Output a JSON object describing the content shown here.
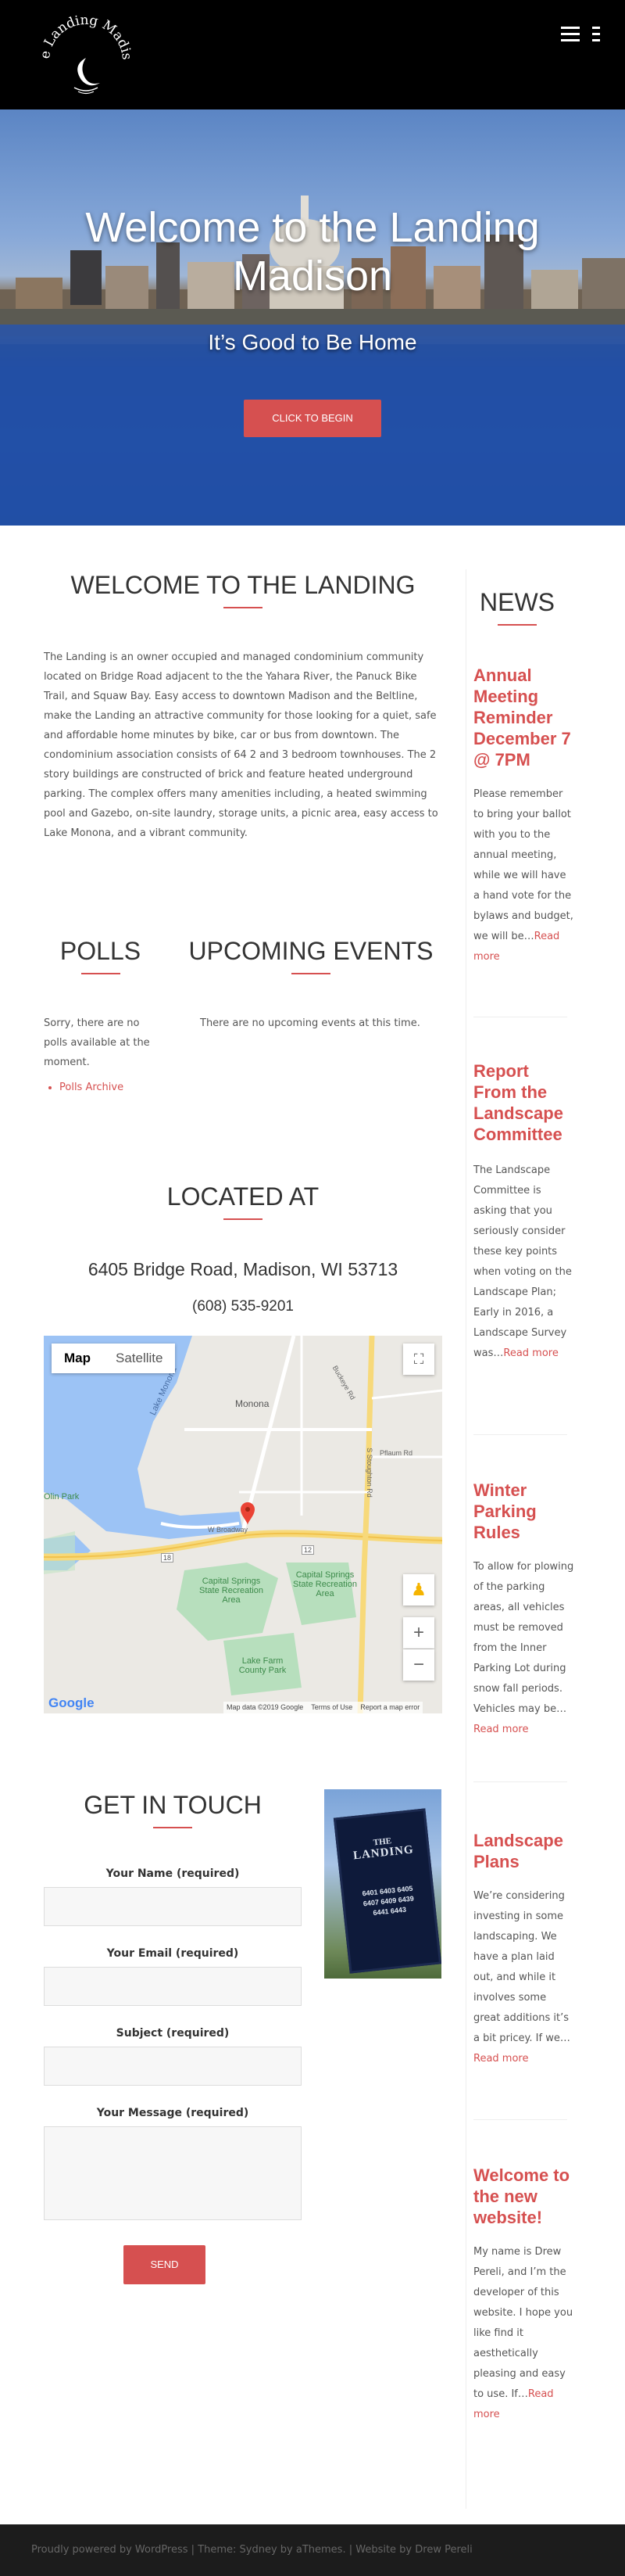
{
  "site": {
    "logo_text": "The Landing Madison",
    "menu_icon": "hamburger-icon"
  },
  "hero": {
    "title": "Welcome to the Landing Madison",
    "subtitle": "It’s Good to Be Home",
    "button": "CLICK TO BEGIN"
  },
  "welcome": {
    "heading": "WELCOME TO THE LANDING",
    "text": "The Landing is an owner occupied and managed condominium community located on Bridge Road adjacent to the the Yahara River, the Panuck Bike Trail, and Squaw Bay. Easy access to downtown Madison and the Beltline, make the Landing an attractive community for those looking for a quiet, safe and affordable home minutes by bike, car or bus from downtown. The condominium association consists of 64 2 and 3 bedroom townhouses. The 2 story buildings are constructed of brick and feature heated underground parking. The complex offers many amenities including, a heated swimming pool and Gazebo, on-site laundry, storage units, a picnic area, easy access to Lake Monona, and a vibrant community."
  },
  "polls": {
    "heading": "POLLS",
    "text": "Sorry, there are no polls available at the moment.",
    "archive_link": "Polls Archive"
  },
  "events": {
    "heading": "UPCOMING EVENTS",
    "text": "There are no upcoming events at this time."
  },
  "location": {
    "heading": "LOCATED AT",
    "address": "6405 Bridge Road, Madison, WI 53713",
    "phone": "(608) 535-9201"
  },
  "map": {
    "tab_map": "Map",
    "tab_satellite": "Satellite",
    "labels": {
      "monona": "Monona",
      "lake_monona": "Lake Monona",
      "olin_park": "Olin Park",
      "capital_springs_1": "Capital Springs State Recreation Area",
      "capital_springs_2": "Capital Springs State Recreation Area",
      "lake_farm": "Lake Farm County Park",
      "broadway": "W Broadway",
      "route_18": "18",
      "route_12": "12",
      "stoughton_rd": "S Stoughton Rd",
      "buckeye_rd": "Buckeye Rd",
      "pflaum_rd": "Pflaum Rd"
    },
    "attribution": "Map data ©2019 Google",
    "terms": "Terms of Use",
    "report": "Report a map error",
    "google": "Google",
    "zoom_in": "+",
    "zoom_out": "−"
  },
  "contact": {
    "heading": "GET IN TOUCH",
    "name_label": "Your Name (required)",
    "email_label": "Your Email (required)",
    "subject_label": "Subject (required)",
    "message_label": "Your Message (required)",
    "send": "SEND",
    "sign_line1": "THE",
    "sign_line2": "LANDING",
    "sign_numbers": "6401 6403 6405\n6407 6409 6439\n6441 6443"
  },
  "news": {
    "heading": "NEWS",
    "read_more": "Read more",
    "posts": [
      {
        "title": "Annual Meeting Reminder December 7 @ 7PM",
        "excerpt": "Please remember to bring your ballot with you to the annual meeting, while we will have a hand vote for the bylaws and budget, we will be…"
      },
      {
        "title": "Report From the Landscape Committee",
        "excerpt": "The Landscape Committee is asking that you seriously consider these key points when voting on the Landscape Plan;  Early in 2016, a Landscape Survey was…"
      },
      {
        "title": "Winter Parking Rules",
        "excerpt": "To allow for plowing of the parking areas, all vehicles must be removed from the Inner Parking Lot during snow fall periods. Vehicles may be…"
      },
      {
        "title": "Landscape Plans",
        "excerpt": "We’re considering investing in some landscaping. We have a plan laid out, and while it involves some great additions it’s a bit pricey. If we…"
      },
      {
        "title": "Welcome to the new website!",
        "excerpt": "My name is Drew Pereli, and I’m the developer of this website. I hope you like find it aesthetically pleasing and easy to use. If…"
      }
    ]
  },
  "footer": {
    "text": "Proudly powered by WordPress | Theme: Sydney by aThemes. | Website by Drew Pereli"
  },
  "colors": {
    "accent": "#d65050",
    "header_bg": "#000000",
    "footer_bg": "#1c1c1c"
  }
}
